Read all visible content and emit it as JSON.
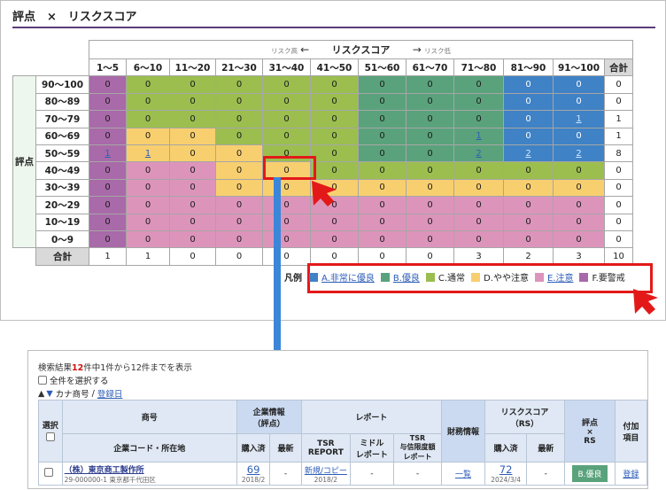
{
  "title": "評点　×　リスクスコア",
  "axis": {
    "low": "リスク高",
    "arrow_left": "←",
    "center": "リスクスコア",
    "arrow_right": "→",
    "high": "リスク低"
  },
  "columns": [
    "1〜5",
    "6〜10",
    "11〜20",
    "21〜30",
    "31〜40",
    "41〜50",
    "51〜60",
    "61〜70",
    "71〜80",
    "81〜90",
    "91〜100",
    "合計"
  ],
  "side_label": "評点",
  "rows": [
    {
      "label": "90〜100",
      "cells": [
        "0",
        "0",
        "0",
        "0",
        "0",
        "0",
        "0",
        "0",
        "0",
        "0",
        "0"
      ],
      "total": "0"
    },
    {
      "label": "80〜89",
      "cells": [
        "0",
        "0",
        "0",
        "0",
        "0",
        "0",
        "0",
        "0",
        "0",
        "0",
        "0"
      ],
      "total": "0"
    },
    {
      "label": "70〜79",
      "cells": [
        "0",
        "0",
        "0",
        "0",
        "0",
        "0",
        "0",
        "0",
        "0",
        "0",
        "1"
      ],
      "total": "1"
    },
    {
      "label": "60〜69",
      "cells": [
        "0",
        "0",
        "0",
        "0",
        "0",
        "0",
        "0",
        "0",
        "1",
        "0",
        "0"
      ],
      "total": "1"
    },
    {
      "label": "50〜59",
      "cells": [
        "1",
        "1",
        "0",
        "0",
        "0",
        "0",
        "0",
        "0",
        "2",
        "2",
        "2"
      ],
      "total": "8"
    },
    {
      "label": "40〜49",
      "cells": [
        "0",
        "0",
        "0",
        "0",
        "0",
        "0",
        "0",
        "0",
        "0",
        "0",
        "0"
      ],
      "total": "0"
    },
    {
      "label": "30〜39",
      "cells": [
        "0",
        "0",
        "0",
        "0",
        "0",
        "0",
        "0",
        "0",
        "0",
        "0",
        "0"
      ],
      "total": "0"
    },
    {
      "label": "20〜29",
      "cells": [
        "0",
        "0",
        "0",
        "0",
        "0",
        "0",
        "0",
        "0",
        "0",
        "0",
        "0"
      ],
      "total": "0"
    },
    {
      "label": "10〜19",
      "cells": [
        "0",
        "0",
        "0",
        "0",
        "0",
        "0",
        "0",
        "0",
        "0",
        "0",
        "0"
      ],
      "total": "0"
    },
    {
      "label": "0〜9",
      "cells": [
        "0",
        "0",
        "0",
        "0",
        "0",
        "0",
        "0",
        "0",
        "0",
        "0",
        "0"
      ],
      "total": "0"
    }
  ],
  "total_row": {
    "label": "合計",
    "cells": [
      "1",
      "1",
      "0",
      "0",
      "0",
      "0",
      "0",
      "3",
      "2",
      "3"
    ],
    "grand": "10"
  },
  "legend": {
    "label": "凡例",
    "items": [
      {
        "text": "A.非常に優良",
        "color": "#3f82c5",
        "link": true
      },
      {
        "text": "B.優良",
        "color": "#5aa27c",
        "link": true
      },
      {
        "text": "C.通常",
        "color": "#9bbe4f",
        "link": false
      },
      {
        "text": "D.やや注意",
        "color": "#f8cf6f",
        "link": false
      },
      {
        "text": "E.注意",
        "color": "#dd94bb",
        "link": true
      },
      {
        "text": "F.要警戒",
        "color": "#a86aa8",
        "link": false
      }
    ]
  },
  "results": {
    "count_prefix": "検索結果",
    "count": "12",
    "count_suffix": "件中1件から12件までを表示",
    "select_all": "全件を選択する",
    "sort_up": "▲",
    "sort_down": "▼",
    "sort_kana": "カナ商号",
    "sort_sep": "/",
    "sort_date": "登録日",
    "headers": {
      "select": "選択",
      "name": "商号",
      "code": "企業コード・所在地",
      "corp_info": "企業情報",
      "corp_info_sub": "（評点）",
      "purchased": "購入済",
      "latest": "最新",
      "report": "レポート",
      "tsr_report": "TSR\nREPORT",
      "middle_report": "ミドル\nレポート",
      "tsr_limit": "TSR\n与信限度額\nレポート",
      "financial": "財務情報",
      "risk_score": "リスクスコア",
      "risk_score_sub": "（RS）",
      "purchased2": "購入済",
      "latest2": "最新",
      "score_rs": "評点\n×\nRS",
      "extra": "付加\n項目"
    },
    "row": {
      "company": "（株）東京商工製作所",
      "address": "29-000000-1 東京都千代田区",
      "score": "69",
      "score_date": "2018/2",
      "latest": "-",
      "tsr_link": "新規/コピー",
      "tsr_date": "2018/2",
      "middle": "-",
      "limit": "-",
      "financial": "一覧",
      "rs": "72",
      "rs_date": "2024/3/4",
      "rs_latest": "-",
      "grade": "B.優良",
      "register": "登録"
    }
  }
}
